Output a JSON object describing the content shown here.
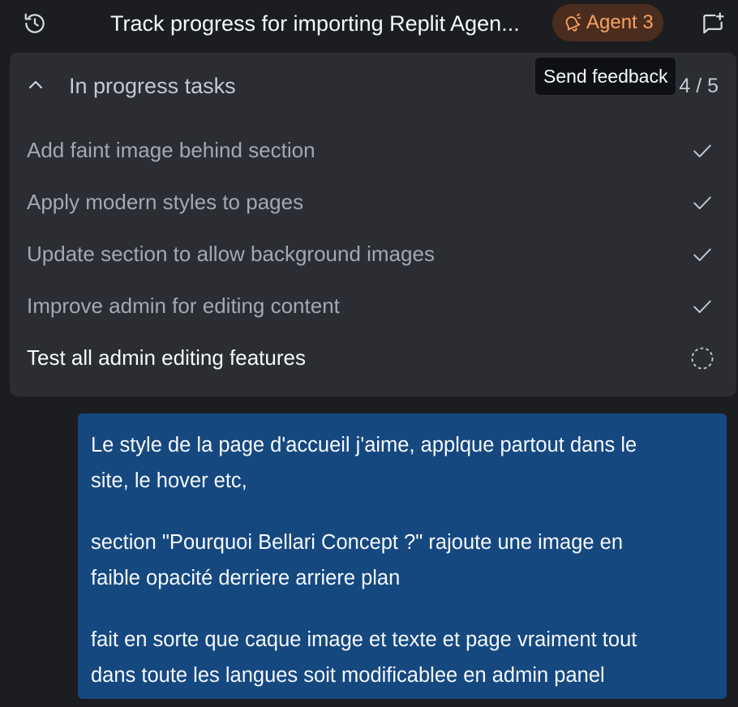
{
  "header": {
    "title": "Track progress for importing Replit Agen...",
    "agent_badge_label": "Agent 3",
    "icons": {
      "history": "history-icon",
      "agent": "bell-icon",
      "feedback": "message-plus-icon"
    }
  },
  "tooltip": {
    "text": "Send feedback"
  },
  "tasks": {
    "title": "In progress tasks",
    "count": "4 / 5",
    "items": [
      {
        "label": "Add faint image behind section",
        "status": "done"
      },
      {
        "label": "Apply modern styles to pages",
        "status": "done"
      },
      {
        "label": "Update section to allow background images",
        "status": "done"
      },
      {
        "label": "Improve admin for editing content",
        "status": "done"
      },
      {
        "label": "Test all admin editing features",
        "status": "in-progress"
      }
    ]
  },
  "message": {
    "paragraphs": [
      {
        "lines": [
          "Le style de la page d'accueil j'aime, applque partout dans le",
          "site, le hover etc,"
        ]
      },
      {
        "lines": [
          "section \"Pourquoi Bellari Concept ?\" rajoute une image en",
          "faible opacité derriere arriere plan"
        ]
      },
      {
        "lines": [
          "fait en sorte que caque image et texte et page vraiment tout",
          "dans toute les langues soit modificablee en admin panel"
        ]
      }
    ]
  },
  "colors": {
    "background": "#1c1d21",
    "panel": "#2b2d33",
    "message_bubble": "#164880",
    "agent_badge_bg": "#4a2d1f",
    "agent_badge_text": "#f8a15e",
    "muted_text": "#a3a8b2",
    "primary_text": "#f5f9fc"
  }
}
